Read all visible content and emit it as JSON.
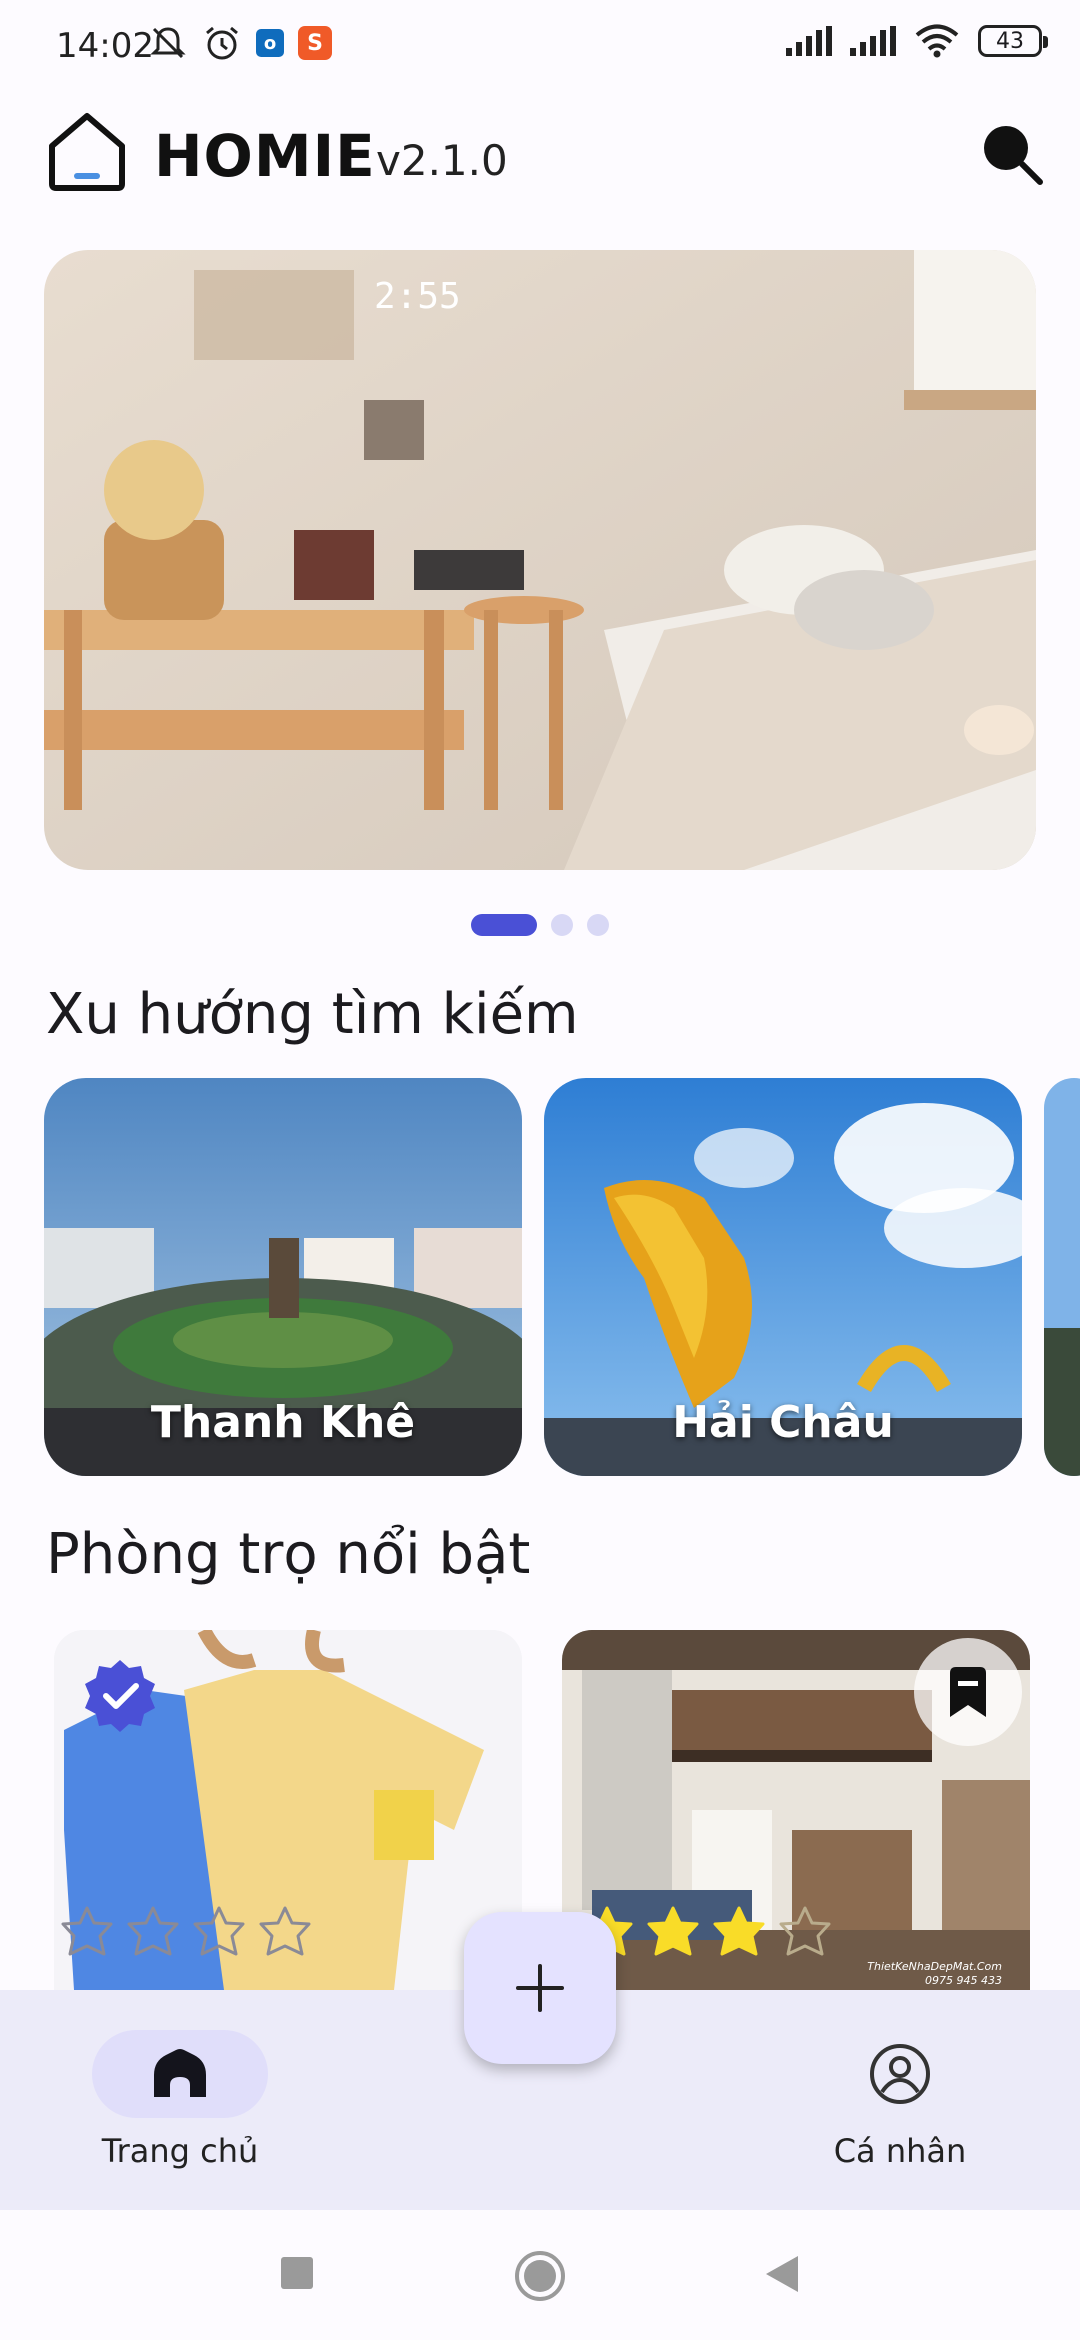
{
  "status_bar": {
    "time": "14:02",
    "battery": "43",
    "notification_icons": [
      "mute-icon",
      "alarm-icon",
      "outlook-icon",
      "shopee-icon"
    ],
    "right_icons": [
      "signal-icon",
      "signal-icon",
      "wifi-icon",
      "battery-icon"
    ]
  },
  "header": {
    "app_name": "HOMIE",
    "version": "v2.1.0",
    "search_icon": "search-icon"
  },
  "banner": {
    "clock_text": "2:55",
    "page_count": 3,
    "active_index": 0
  },
  "trending": {
    "title": "Xu hướng tìm kiếm",
    "items": [
      {
        "label": "Thanh Khê"
      },
      {
        "label": "Hải Châu"
      }
    ]
  },
  "featured": {
    "title": "Phòng trọ nổi bật",
    "items": [
      {
        "verified": true,
        "rating": 0,
        "max_rating": 4
      },
      {
        "bookmarked": true,
        "rating": 3,
        "max_rating": 4,
        "watermark": "ThietKeNhaDepMat.Com",
        "watermark_phone": "0975 945 433"
      }
    ]
  },
  "bottom_nav": {
    "items": [
      {
        "label": "Trang chủ",
        "icon": "home-icon",
        "active": true
      },
      {
        "label": "Cá nhân",
        "icon": "person-icon",
        "active": false
      }
    ],
    "fab_icon": "plus-icon"
  },
  "colors": {
    "accent": "#4a50d6",
    "nav_bg": "#ecebf9",
    "nav_active_pill": "#e0defa",
    "star_fill": "#f9dc28"
  }
}
